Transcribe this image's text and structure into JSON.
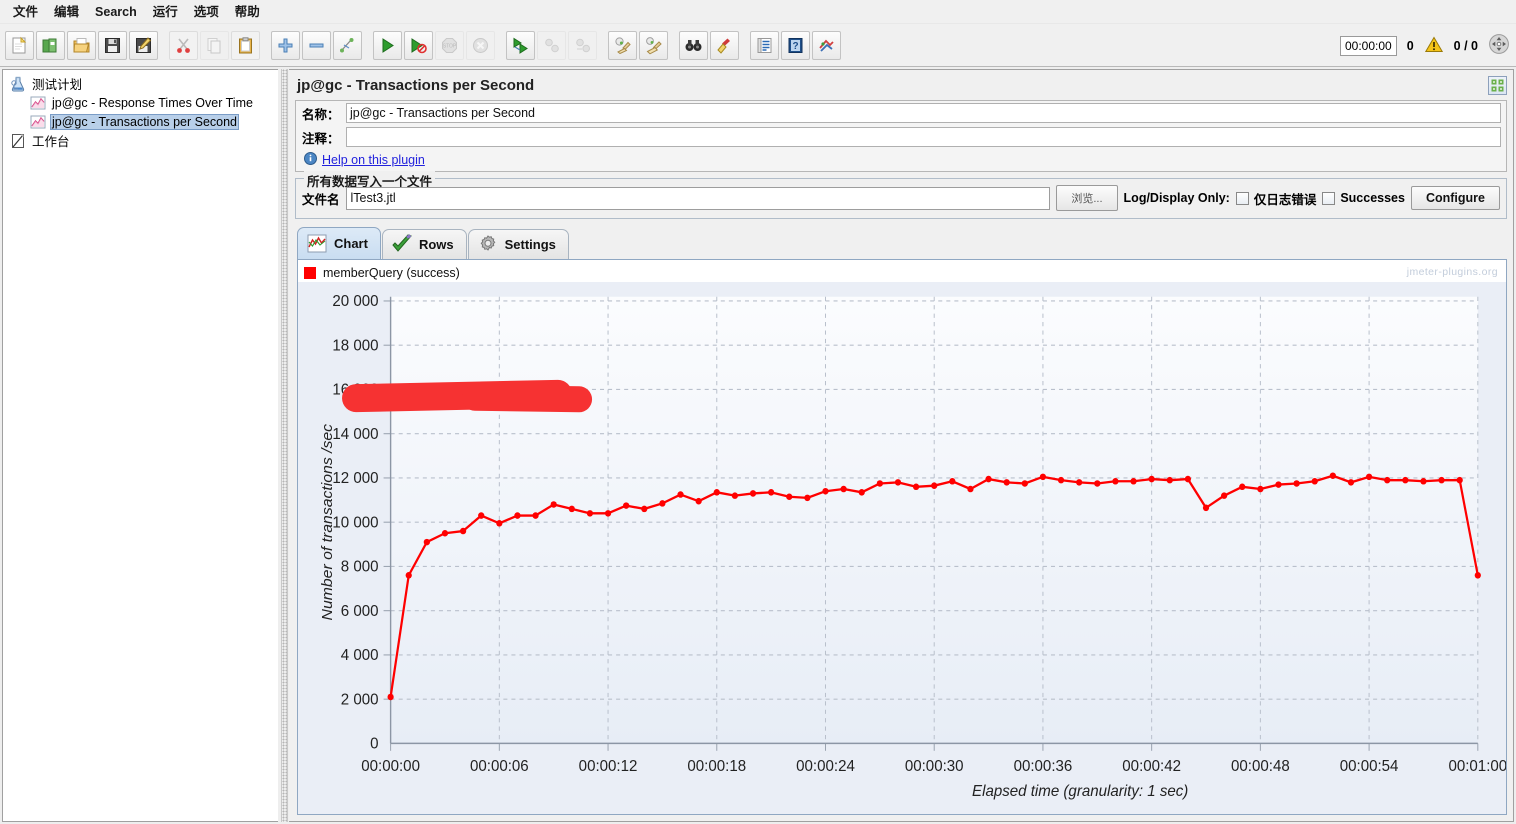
{
  "menu": {
    "items": [
      {
        "name": "file",
        "label": "文件"
      },
      {
        "name": "edit",
        "label": "编辑"
      },
      {
        "name": "search",
        "label": "Search"
      },
      {
        "name": "run",
        "label": "运行"
      },
      {
        "name": "options",
        "label": "选项"
      },
      {
        "name": "help",
        "label": "帮助"
      }
    ]
  },
  "toolbar": {
    "buttons": [
      {
        "name": "new",
        "icon": "new-document-icon"
      },
      {
        "name": "templates",
        "icon": "templates-icon"
      },
      {
        "name": "open",
        "icon": "open-folder-icon"
      },
      {
        "name": "save",
        "icon": "save-disk-icon"
      },
      {
        "name": "save-as",
        "icon": "save-as-icon"
      },
      {
        "name": "cut",
        "icon": "scissors-icon"
      },
      {
        "name": "copy",
        "icon": "copy-icon"
      },
      {
        "name": "paste",
        "icon": "clipboard-paste-icon"
      },
      {
        "name": "expand-all",
        "icon": "plus-icon"
      },
      {
        "name": "collapse-all",
        "icon": "minus-icon"
      },
      {
        "name": "toggle",
        "icon": "toggle-icon"
      },
      {
        "name": "start",
        "icon": "play-green-icon"
      },
      {
        "name": "start-no-timers",
        "icon": "play-no-timers-icon"
      },
      {
        "name": "stop",
        "icon": "stop-sign-icon"
      },
      {
        "name": "shutdown",
        "icon": "shutdown-x-icon"
      },
      {
        "name": "start-remote-all",
        "icon": "remote-start-icon"
      },
      {
        "name": "stop-remote-all",
        "icon": "remote-stop-icon"
      },
      {
        "name": "shutdown-remote-all",
        "icon": "remote-shutdown-icon"
      },
      {
        "name": "clear",
        "icon": "broom-clear-icon"
      },
      {
        "name": "clear-all",
        "icon": "broom-clear-all-icon"
      },
      {
        "name": "search",
        "icon": "binoculars-icon"
      },
      {
        "name": "search-reset",
        "icon": "broom-yellow-icon"
      },
      {
        "name": "function-helper",
        "icon": "function-list-icon"
      },
      {
        "name": "help",
        "icon": "help-book-icon"
      },
      {
        "name": "plugins-manager",
        "icon": "plugins-manager-icon"
      }
    ],
    "status": {
      "timer": "00:00:00",
      "error_count": "0",
      "warning_icon": "warning-triangle-icon",
      "threads": "0 / 0",
      "expand_icon": "fit-view-icon"
    }
  },
  "tree": {
    "nodes": [
      {
        "name": "test-plan",
        "label": "测试计划",
        "icon": "test-plan-icon",
        "level": 0,
        "selected": false
      },
      {
        "name": "response-times-over-time",
        "label": "jp@gc - Response Times Over Time",
        "icon": "chart-listener-icon",
        "level": 1,
        "selected": false
      },
      {
        "name": "transactions-per-second",
        "label": "jp@gc - Transactions per Second",
        "icon": "chart-listener-icon",
        "level": 1,
        "selected": true
      },
      {
        "name": "workbench",
        "label": "工作台",
        "icon": "workbench-icon",
        "level": 0,
        "selected": false
      }
    ]
  },
  "panel": {
    "title": "jp@gc - Transactions per Second",
    "plugin_icon": "puzzle-piece-icon",
    "name_label": "名称：",
    "name_value": "jp@gc - Transactions per Second",
    "comment_label": "注释：",
    "comment_value": "",
    "help_link": "Help on this plugin",
    "help_icon": "info-icon"
  },
  "file_group": {
    "title": "所有数据写入一个文件",
    "filename_label": "文件名",
    "filename_value": "lTest3.jtl",
    "browse_label": "浏览...",
    "log_display_label": "Log/Display Only:",
    "errors_only_label": "仅日志错误",
    "errors_only_checked": false,
    "successes_label": "Successes",
    "successes_checked": false,
    "configure_label": "Configure"
  },
  "tabs": [
    {
      "name": "tab-chart",
      "label": "Chart",
      "icon": "line-chart-icon",
      "active": true
    },
    {
      "name": "tab-rows",
      "label": "Rows",
      "icon": "green-check-icon",
      "active": false
    },
    {
      "name": "tab-settings",
      "label": "Settings",
      "icon": "gear-icon",
      "active": false
    }
  ],
  "chart_panel": {
    "watermark": "jmeter-plugins.org",
    "legend_label": "memberQuery (success)",
    "legend_color": "#ff0000"
  },
  "chart_data": {
    "type": "line",
    "title": "",
    "xlabel": "Elapsed time (granularity: 1 sec)",
    "ylabel": "Number of transactions /sec",
    "ylim": [
      0,
      20000
    ],
    "ytick_values": [
      2000,
      4000,
      6000,
      8000,
      10000,
      12000,
      14000,
      16000,
      18000,
      20000
    ],
    "ytick_labels": [
      "2 000",
      "4 000",
      "6 000",
      "8 000",
      "10 000",
      "12 000",
      "14 000",
      "16 000",
      "18 000",
      "20 000"
    ],
    "xlim": [
      0,
      60
    ],
    "xtick_values": [
      0,
      6,
      12,
      18,
      24,
      30,
      36,
      42,
      48,
      54,
      60
    ],
    "xtick_labels": [
      "00:00:00",
      "00:00:06",
      "00:00:12",
      "00:00:18",
      "00:00:24",
      "00:00:30",
      "00:00:36",
      "00:00:42",
      "00:00:48",
      "00:00:54",
      "00:01:00"
    ],
    "grid": true,
    "legend_position": "top-left",
    "series": [
      {
        "name": "memberQuery (success)",
        "color": "#ff0000",
        "x": [
          0,
          1,
          2,
          3,
          4,
          5,
          6,
          7,
          8,
          9,
          10,
          11,
          12,
          13,
          14,
          15,
          16,
          17,
          18,
          19,
          20,
          21,
          22,
          23,
          24,
          25,
          26,
          27,
          28,
          29,
          30,
          31,
          32,
          33,
          34,
          35,
          36,
          37,
          38,
          39,
          40,
          41,
          42,
          43,
          44,
          45,
          46,
          47,
          48,
          49,
          50,
          51,
          52,
          53,
          54,
          55,
          56,
          57,
          58,
          59,
          60
        ],
        "values": [
          2100,
          7600,
          9100,
          9500,
          9600,
          10300,
          9950,
          10300,
          10300,
          10800,
          10600,
          10400,
          10400,
          10750,
          10600,
          10850,
          11250,
          10950,
          11350,
          11200,
          11300,
          11350,
          11150,
          11100,
          11400,
          11500,
          11350,
          11750,
          11800,
          11600,
          11650,
          11850,
          11500,
          11950,
          11800,
          11750,
          12050,
          11900,
          11800,
          11750,
          11850,
          11850,
          11950,
          11900,
          11950,
          10650,
          11200,
          11600,
          11500,
          11700,
          11750,
          11850,
          12100,
          11800,
          12050,
          11900,
          11900,
          11850,
          11900,
          11900,
          7600
        ]
      }
    ]
  }
}
